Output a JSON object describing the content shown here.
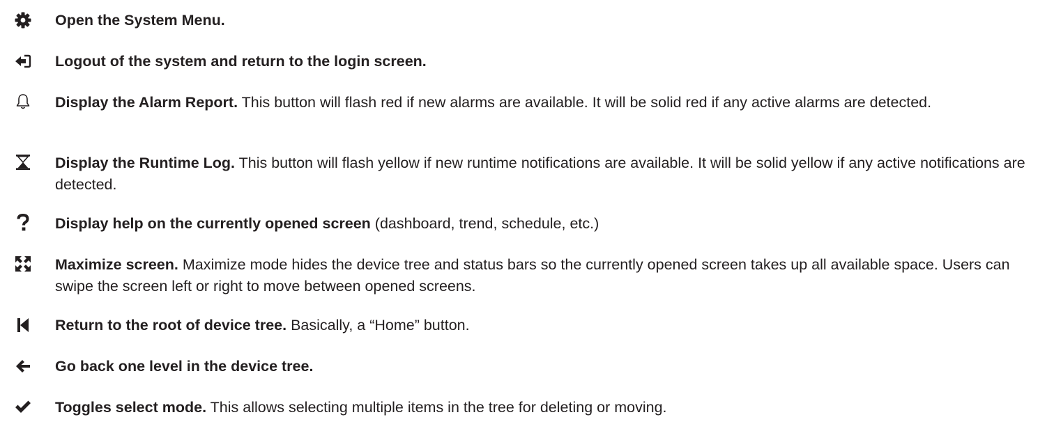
{
  "items": [
    {
      "icon": "gear-icon",
      "title": "Open the System Menu.",
      "desc": ""
    },
    {
      "icon": "logout-icon",
      "title": "Logout of the system and return to the login screen.",
      "desc": ""
    },
    {
      "icon": "bell-icon",
      "title": "Display the Alarm Report.",
      "desc": " This button will flash red if new alarms are available. It will be solid red if any active alarms are detected."
    },
    {
      "icon": "hourglass-icon",
      "title": "Display the Runtime Log.",
      "desc": " This button will flash yellow if new runtime notifications are available. It will be solid yellow if any active notifications are detected."
    },
    {
      "icon": "question-icon",
      "title": "Display help on the currently opened screen",
      "desc": " (dashboard, trend, schedule, etc.)"
    },
    {
      "icon": "maximize-icon",
      "title": "Maximize screen.",
      "desc": " Maximize mode hides the device tree and status bars so the currently opened screen takes up all available space. Users can swipe the screen left or right to move between opened screens."
    },
    {
      "icon": "skip-to-start-icon",
      "title": "Return to the root of device tree.",
      "desc": " Basically, a “Home” button."
    },
    {
      "icon": "arrow-left-icon",
      "title": "Go back one level in the device tree.",
      "desc": ""
    },
    {
      "icon": "checkmark-icon",
      "title": "Toggles select mode.",
      "desc": " This allows selecting multiple items in the tree for deleting or moving."
    }
  ]
}
